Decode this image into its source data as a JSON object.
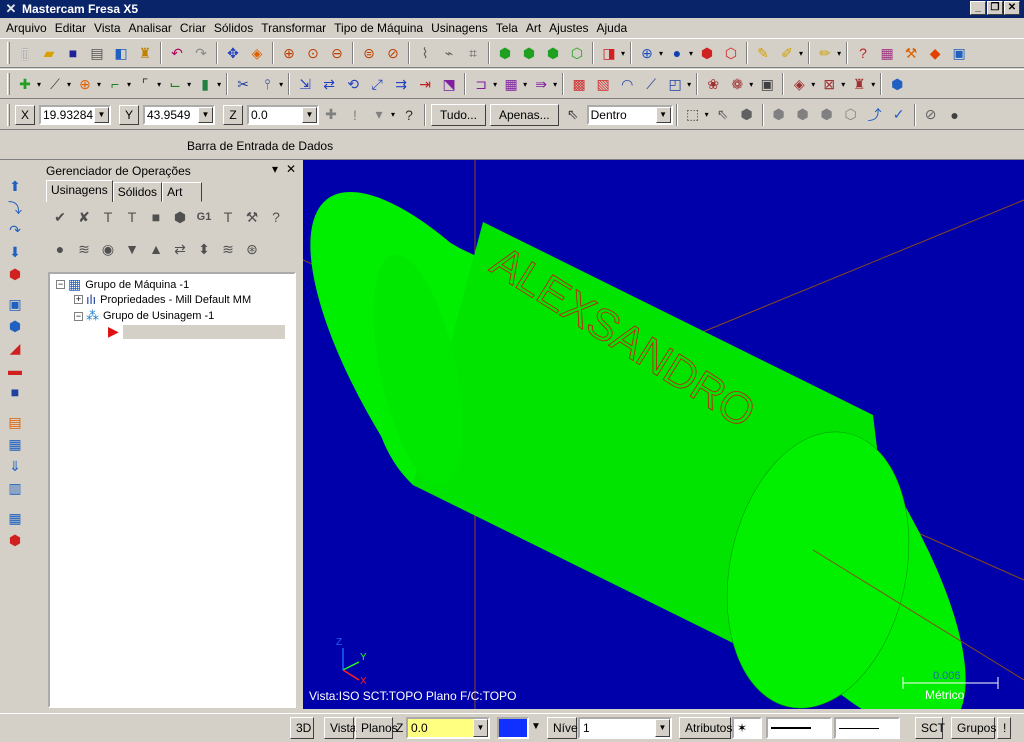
{
  "app": {
    "title": "Mastercam Fresa X5"
  },
  "window_controls": {
    "minimize": "_",
    "restore": "❐",
    "close": "✕"
  },
  "menu": [
    "Arquivo",
    "Editar",
    "Vista",
    "Analisar",
    "Criar",
    "Sólidos",
    "Transformar",
    "Tipo de Máquina",
    "Usinagens",
    "Tela",
    "Art",
    "Ajustes",
    "Ajuda"
  ],
  "autocursor": {
    "x_label": "X",
    "x_value": "19.93284",
    "y_label": "Y",
    "y_value": "43.9549",
    "z_label": "Z",
    "z_value": "0.0",
    "tudo_button": "Tudo...",
    "apenas_button": "Apenas...",
    "mask_value": "Dentro"
  },
  "ribbon": {
    "label": "Barra de Entrada de Dados"
  },
  "opmgr": {
    "title": "Gerenciador de Operações",
    "tabs": [
      "Usinagens",
      "Sólidos",
      "Art"
    ],
    "tree": {
      "machine_group": "Grupo de Máquina -1",
      "properties": "Propriedades - Mill Default MM",
      "toolpath_group": "Grupo de Usinagem -1"
    }
  },
  "viewport": {
    "engraved_text": "ALEXSANDRO",
    "status": "Vista:ISO   SCT:TOPO   Plano F/C:TOPO",
    "scale_value": "0.006",
    "scale_unit": "Métrico",
    "axis_x": "X",
    "axis_y": "Y",
    "axis_z": "Z",
    "colors": {
      "background": "#0000aa",
      "solid": "#00ee00",
      "engraving": "#d01010",
      "axis_lines": "#8a4a1a"
    }
  },
  "statusbar": {
    "view3d": "3D",
    "vista": "Vista",
    "planos": "Planos",
    "z_label": "Z",
    "z_value": "0.0",
    "nivel_label": "Nível",
    "nivel_value": "1",
    "atributos": "Atributos",
    "sct": "SCT",
    "grupos": "Grupos",
    "help": "!"
  }
}
